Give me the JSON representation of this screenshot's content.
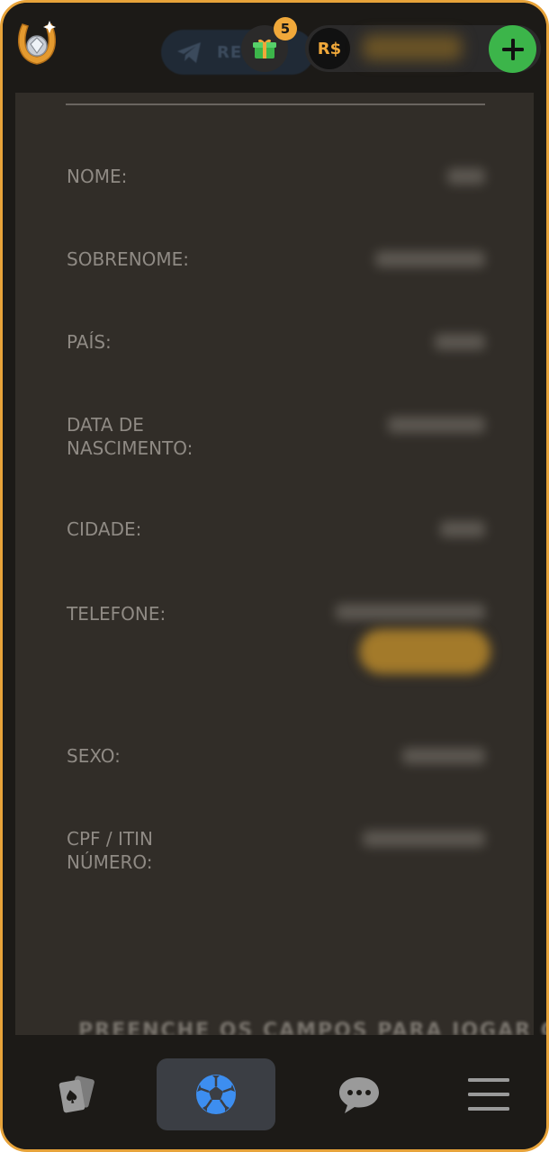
{
  "header": {
    "telegram_label": "RESIDE",
    "gift_count": "5",
    "currency_symbol": "R$",
    "icons": {
      "logo": "horseshoe-diamond-logo",
      "gift": "gift-box-icon",
      "add": "plus-icon",
      "telegram": "telegram-icon"
    }
  },
  "form": {
    "fields": [
      {
        "label": "NOME:"
      },
      {
        "label": "SOBRENOME:"
      },
      {
        "label": "PAÍS:"
      },
      {
        "label": "DATA DE NASCIMENTO:"
      },
      {
        "label": "CIDADE:"
      },
      {
        "label": "TELEFONE:"
      },
      {
        "label": "SEXO:"
      },
      {
        "label": "CPF / ITIN NÚMERO:"
      }
    ],
    "bottom_hint": "PREENCHE OS CAMPOS PARA JOGAR COM"
  },
  "nav": {
    "items": [
      {
        "name": "casino",
        "icon": "playing-cards-icon",
        "active": false
      },
      {
        "name": "sports",
        "icon": "soccer-ball-icon",
        "active": true
      },
      {
        "name": "chat",
        "icon": "chat-bubble-icon",
        "active": false
      },
      {
        "name": "menu",
        "icon": "hamburger-menu-icon",
        "active": false
      }
    ]
  },
  "colors": {
    "accent": "#f0a83a",
    "add_button": "#3cb54a",
    "panel": "#312d28",
    "background": "#1c1a17",
    "active_nav": "#3b3e44",
    "sports_icon": "#3d8ef0"
  }
}
